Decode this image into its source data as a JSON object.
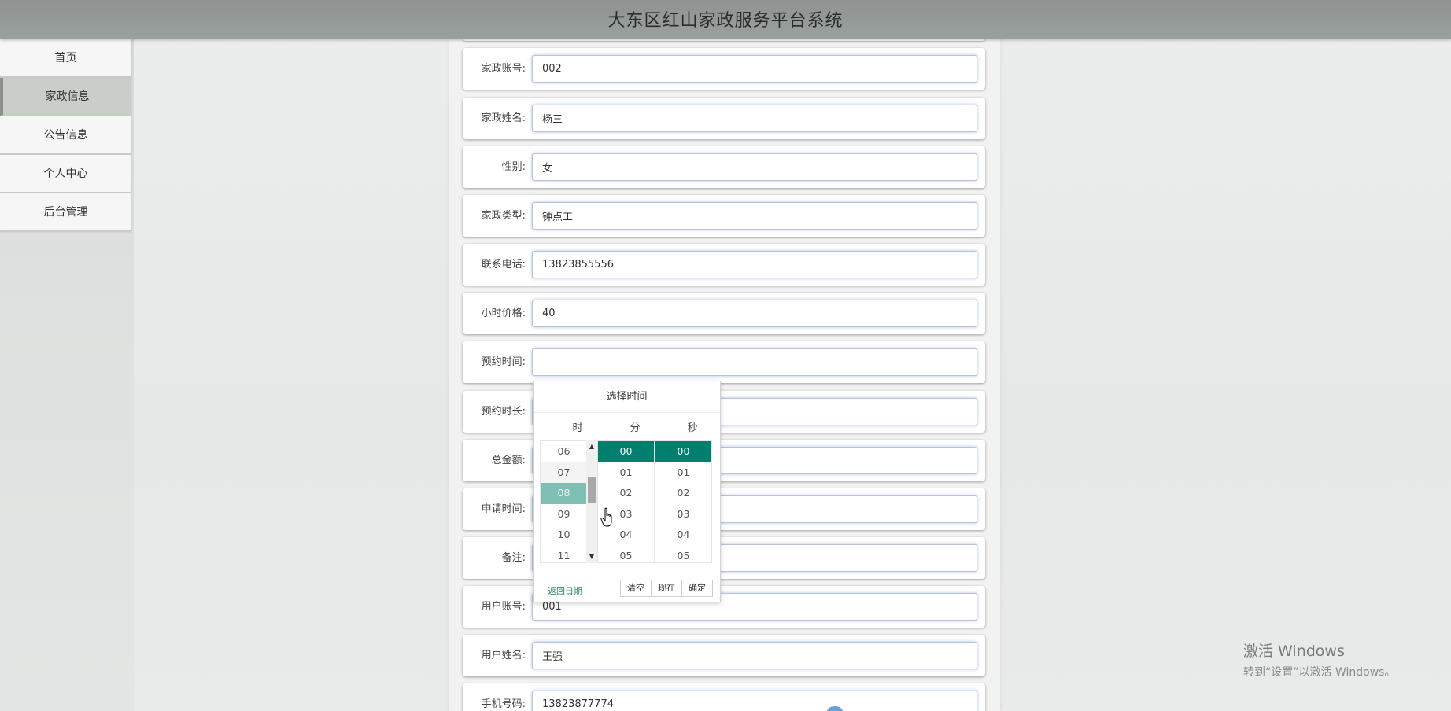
{
  "header": {
    "title": "大东区红山家政服务平台系统"
  },
  "sidebar": {
    "items": [
      {
        "label": "首页"
      },
      {
        "label": "家政信息",
        "active": true
      },
      {
        "label": "公告信息"
      },
      {
        "label": "个人中心"
      },
      {
        "label": "后台管理"
      }
    ]
  },
  "form": {
    "rows": [
      {
        "label": "家政账号:",
        "value": "002"
      },
      {
        "label": "家政姓名:",
        "value": "杨三"
      },
      {
        "label": "性别:",
        "value": "女"
      },
      {
        "label": "家政类型:",
        "value": "钟点工"
      },
      {
        "label": "联系电话:",
        "value": "13823855556"
      },
      {
        "label": "小时价格:",
        "value": "40"
      },
      {
        "label": "预约时间:",
        "value": ""
      },
      {
        "label": "预约时长:",
        "value": ""
      },
      {
        "label": "总金额:",
        "value": ""
      },
      {
        "label": "申请时间:",
        "value": ""
      },
      {
        "label": "备注:",
        "value": ""
      },
      {
        "label": "用户账号:",
        "value": "001"
      },
      {
        "label": "用户姓名:",
        "value": "王强"
      },
      {
        "label": "手机号码:",
        "value": "13823877774"
      }
    ]
  },
  "time_picker": {
    "title": "选择时间",
    "headers": {
      "hour": "时",
      "minute": "分",
      "second": "秒"
    },
    "hours": [
      "06",
      "07",
      "08",
      "09",
      "10",
      "11"
    ],
    "minutes": [
      "00",
      "01",
      "02",
      "03",
      "04",
      "05"
    ],
    "seconds": [
      "00",
      "01",
      "02",
      "03",
      "04",
      "05"
    ],
    "highlighted_hour": "08",
    "selected_minute": "00",
    "selected_second": "00",
    "back_label": "返回日期",
    "clear_label": "清空",
    "now_label": "现在",
    "ok_label": "确定",
    "accent_color": "#007f6e"
  },
  "watermark": {
    "line1": "激活 Windows",
    "line2": "转到“设置”以激活 Windows。"
  }
}
